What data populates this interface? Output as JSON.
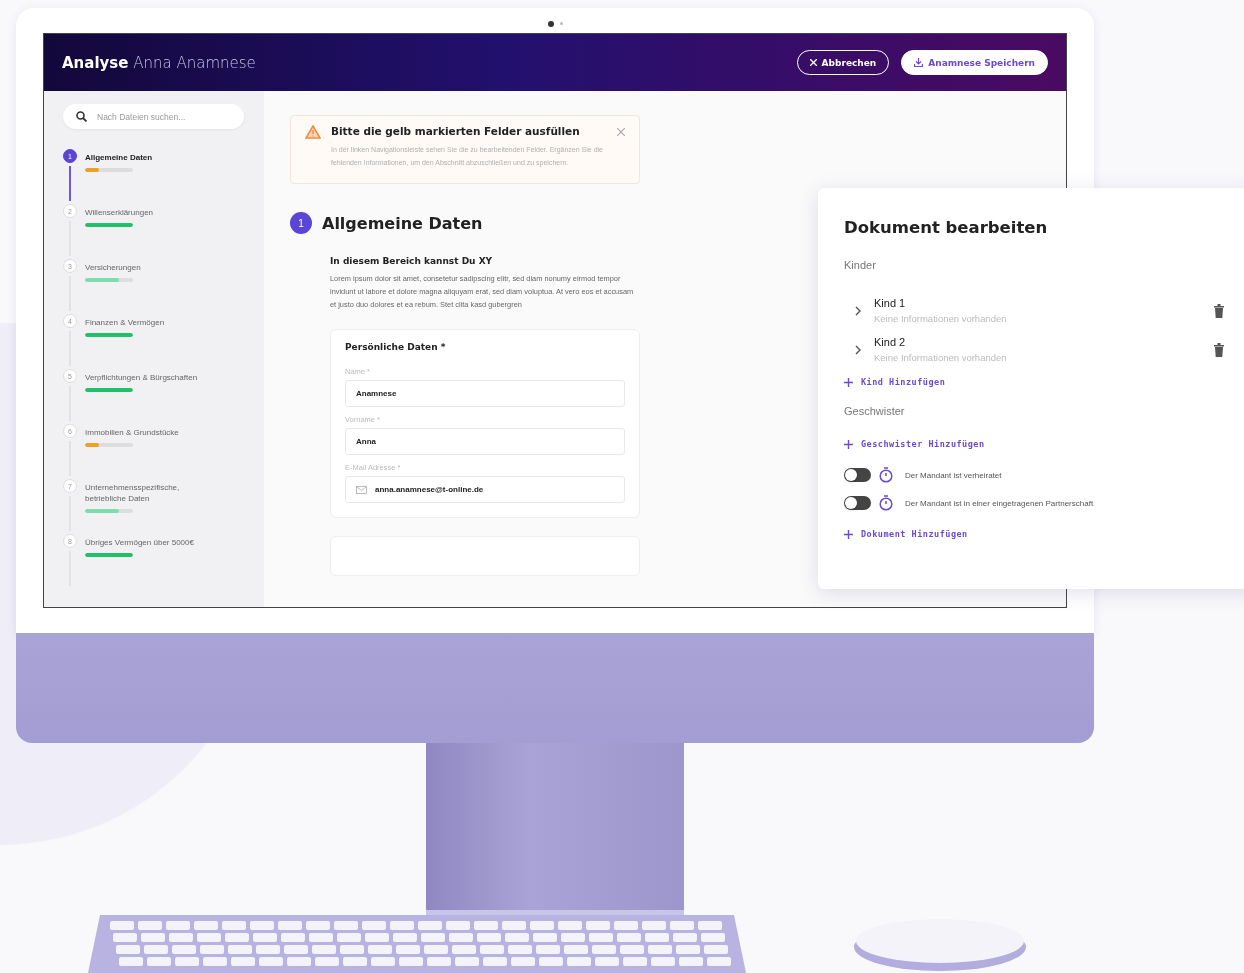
{
  "pager": [
    {
      "selected": true
    },
    {
      "selected": false
    }
  ],
  "header": {
    "title_bold": "Analyse",
    "title": "Anna Anamnese",
    "buttons": [
      {
        "label": "Abbrechen",
        "kind": "outline"
      },
      {
        "label": "Anamnese Speichern",
        "kind": "filled"
      }
    ]
  },
  "search": {
    "placeholder": "Nach Dateien suchen..."
  },
  "steps": [
    {
      "number": "1",
      "label": "Allgemeine Daten",
      "selected": true,
      "level": 0.3,
      "color": "#f0a020"
    },
    {
      "number": "2",
      "label": "Willenserklärungen",
      "selected": false,
      "level": 1,
      "color": "#22c06a"
    },
    {
      "number": "3",
      "label": "Versicherungen",
      "selected": false,
      "level": 0.7,
      "color": "#7fdcae"
    },
    {
      "number": "4",
      "label": "Finanzen & Vermögen",
      "selected": false,
      "level": 1,
      "color": "#22c06a"
    },
    {
      "number": "5",
      "label": "Verpflichtungen & Bürgschaften",
      "selected": false,
      "level": 1,
      "color": "#22c06a"
    },
    {
      "number": "6",
      "label": "Immobilien & Grundstücke",
      "selected": false,
      "level": 0.3,
      "color": "#f0a020"
    },
    {
      "number": "7",
      "label": "Unternehmensspezifische, betriebliche Daten",
      "selected": false,
      "level": 0.7,
      "color": "#7fdcae"
    },
    {
      "number": "8",
      "label": "Übriges Vermögen über 5000€",
      "selected": false,
      "level": 1,
      "color": "#22c06a"
    }
  ],
  "alert": {
    "title": "Bitte die gelb markierten Felder ausfüllen",
    "text": "In der linken Navigationsleiste sehen Sie die zu bearbeitenden Felder. Ergänzen Sie die fehlenden Informationen, um den Abschnitt abzuschließen und zu speichern."
  },
  "section": {
    "number": "1",
    "title": "Allgemeine Daten",
    "subtitle": "In diesem Bereich kannst Du XY",
    "text": "Lorem ipsum dolor sit amet, consetetur sadipscing elitr, sed diam nonumy eirmod tempor invidunt ut labore et dolore magna aliquyam erat, sed diam voluptua. At vero eos et accusam et justo duo dolores et ea rebum. Stet clita kasd gubergren"
  },
  "form": {
    "title": "Persönliche Daten *",
    "fields": [
      {
        "label": "Name *",
        "value": "Anamnese",
        "kind": "text"
      },
      {
        "label": "Vorname *",
        "value": "Anna",
        "kind": "text"
      },
      {
        "label": "E-Mail Adresse *",
        "value": "anna.anamnese@t-online.de",
        "kind": "email"
      }
    ]
  },
  "panel": {
    "title": "Dokument bearbeiten",
    "children_label": "Kinder",
    "children": [
      {
        "title": "Kind 1",
        "subtitle": "Keine Informationen vorhanden"
      },
      {
        "title": "Kind 2",
        "subtitle": "Keine Informationen vorhanden"
      }
    ],
    "add_child": "Kind Hinzufügen",
    "siblings_label": "Geschwister",
    "add_sibling": "Geschwister Hinzufügen",
    "toggles": [
      {
        "label": "Der Mandant ist verheiratet",
        "on": false
      },
      {
        "label": "Der Mandant ist in einer eingetragenen Partnerschaft",
        "on": false
      }
    ],
    "add_document": "Dokument Hinzufügen"
  }
}
